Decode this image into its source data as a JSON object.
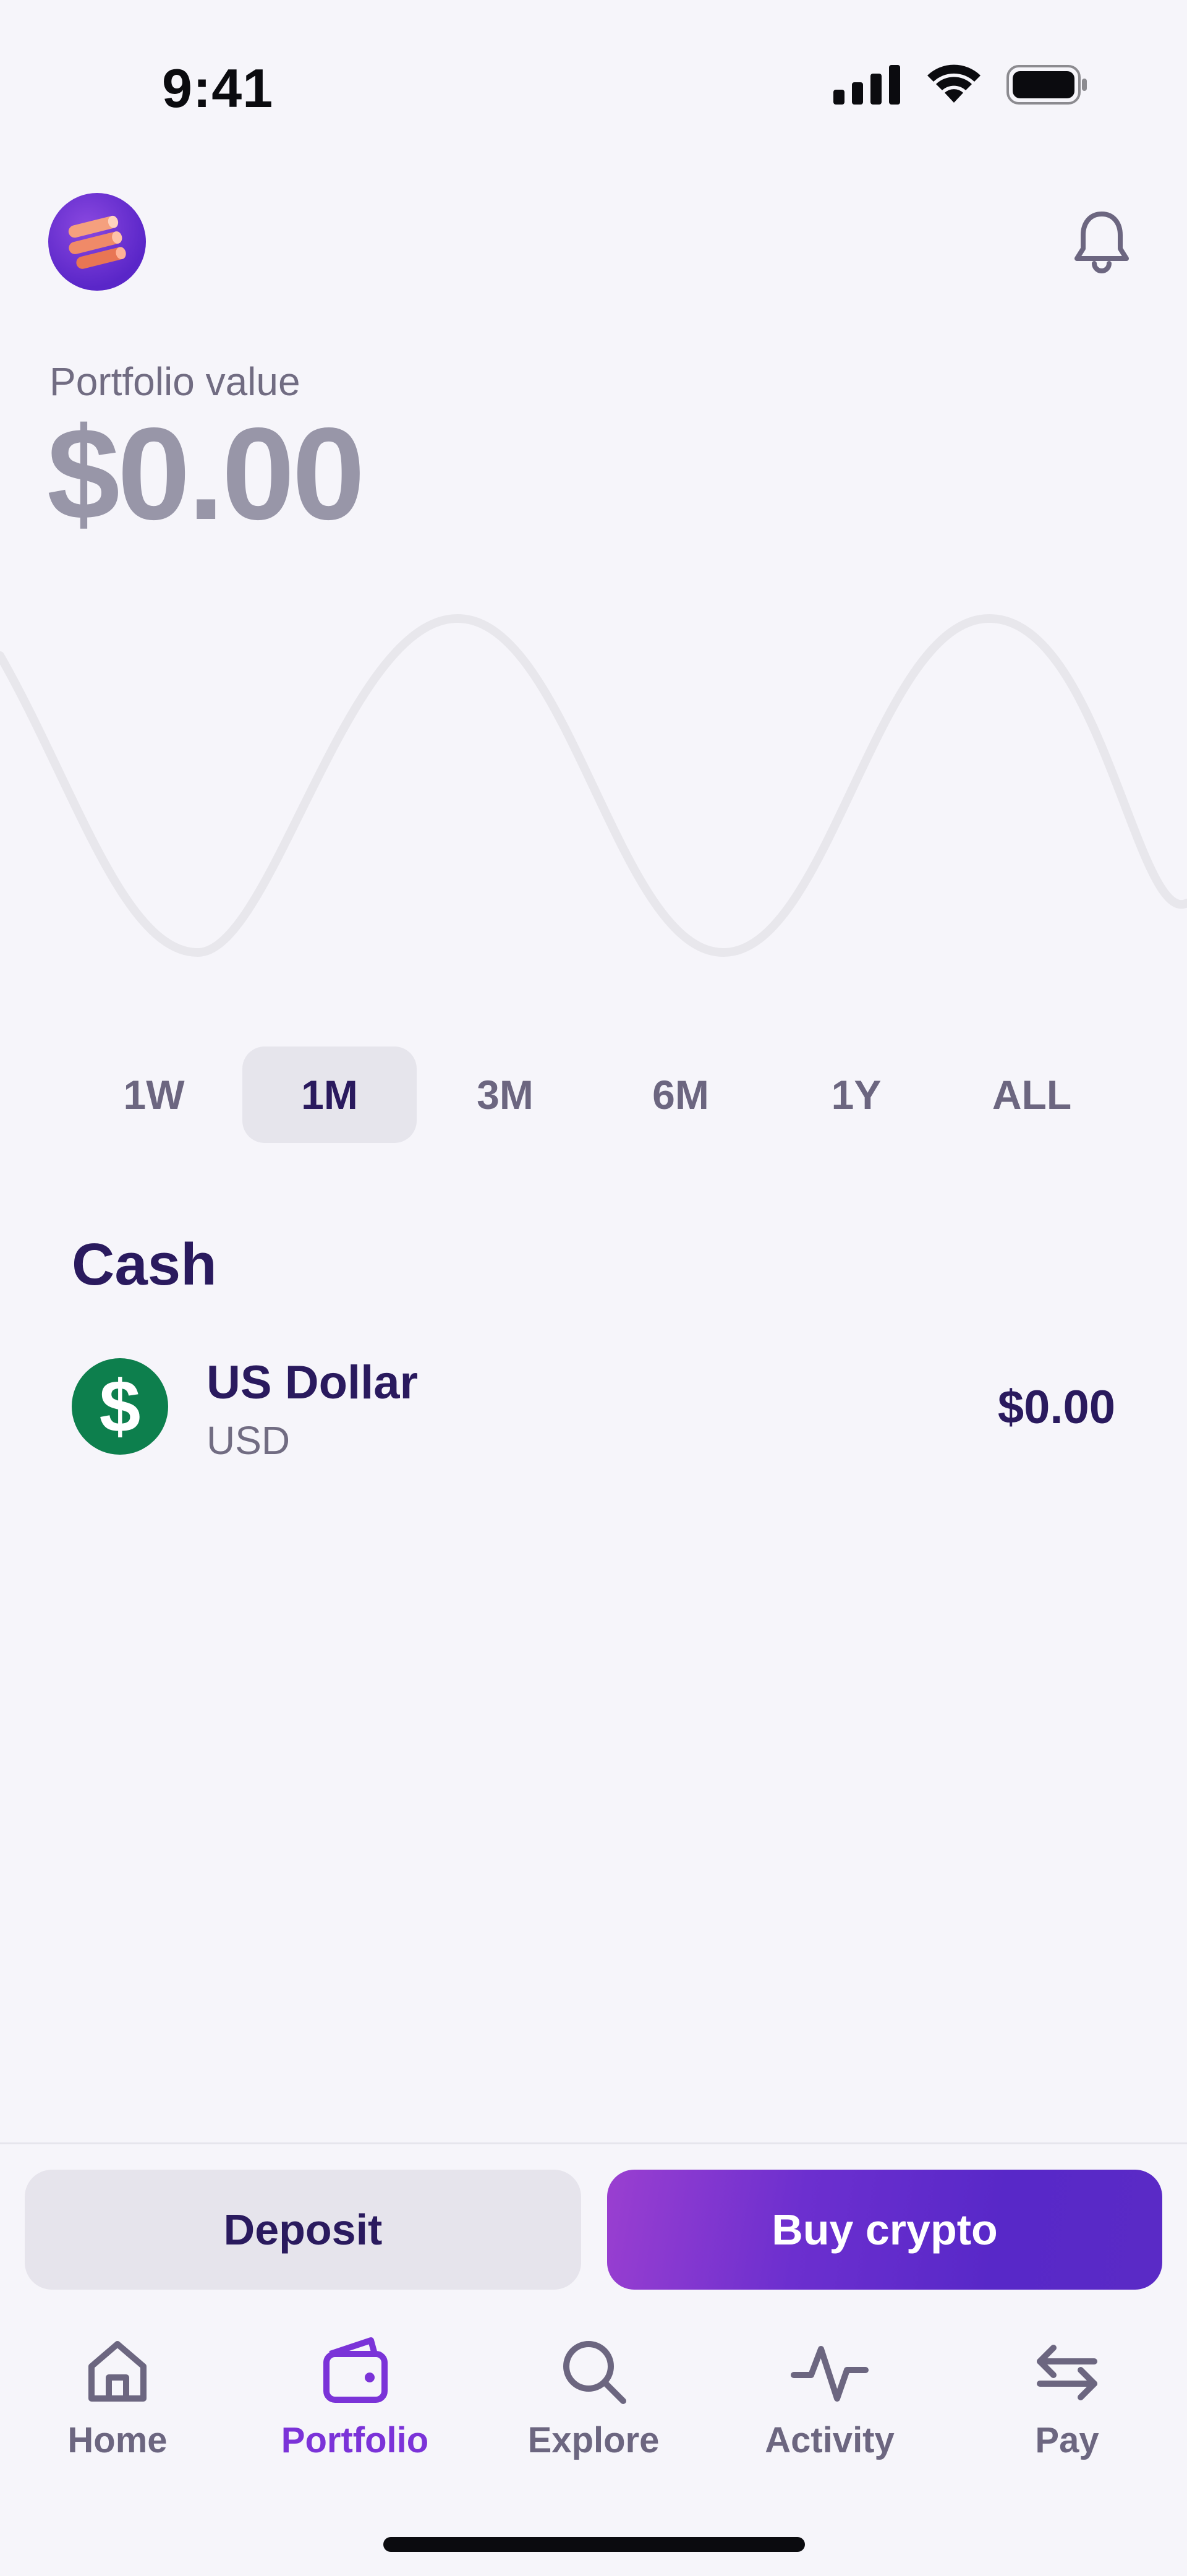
{
  "status_bar": {
    "time": "9:41",
    "icons": [
      "cellular-signal-icon",
      "wifi-icon",
      "battery-icon"
    ]
  },
  "header": {
    "logo_icon": "coin-stack-logo-icon",
    "notification_icon": "bell-icon"
  },
  "portfolio": {
    "label": "Portfolio value",
    "value": "$0.00"
  },
  "timeframes": {
    "options": [
      "1W",
      "1M",
      "3M",
      "6M",
      "1Y",
      "ALL"
    ],
    "selected": "1M"
  },
  "cash": {
    "heading": "Cash",
    "items": [
      {
        "name": "US Dollar",
        "code": "USD",
        "amount": "$0.00",
        "icon": "dollar-sign-icon",
        "icon_color": "#0d7f4d"
      }
    ]
  },
  "actions": {
    "deposit_label": "Deposit",
    "buy_label": "Buy crypto"
  },
  "tab_bar": {
    "items": [
      {
        "label": "Home",
        "icon": "home-icon"
      },
      {
        "label": "Portfolio",
        "icon": "wallet-icon"
      },
      {
        "label": "Explore",
        "icon": "search-icon"
      },
      {
        "label": "Activity",
        "icon": "activity-icon"
      },
      {
        "label": "Pay",
        "icon": "transfer-arrows-icon"
      }
    ],
    "active": "Portfolio"
  },
  "colors": {
    "accent": "#7b33d8",
    "text_primary": "#2a1a5e",
    "text_secondary": "#716c82",
    "background": "#f6f5fa"
  }
}
